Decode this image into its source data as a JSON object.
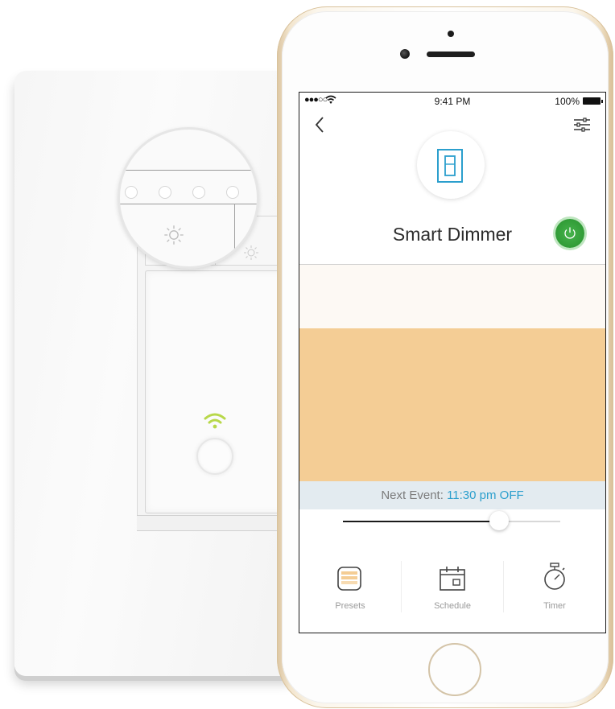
{
  "status_bar": {
    "signal": "●●●○○",
    "time": "9:41 PM",
    "battery": "100%"
  },
  "device": {
    "name": "Smart Dimmer",
    "power": "on",
    "brightness_percent": 72
  },
  "next_event": {
    "label": "Next Event:",
    "value": "11:30 pm OFF"
  },
  "tabs": [
    {
      "label": "Presets",
      "icon": "presets-icon"
    },
    {
      "label": "Schedule",
      "icon": "calendar-icon"
    },
    {
      "label": "Timer",
      "icon": "stopwatch-icon"
    }
  ],
  "colors": {
    "power_on": "#2f9a35",
    "light_glow": "#f4cd95",
    "accent": "#2b9fcd",
    "device_icon": "#2b9fcd",
    "wifi_led": "#b8d84a"
  }
}
